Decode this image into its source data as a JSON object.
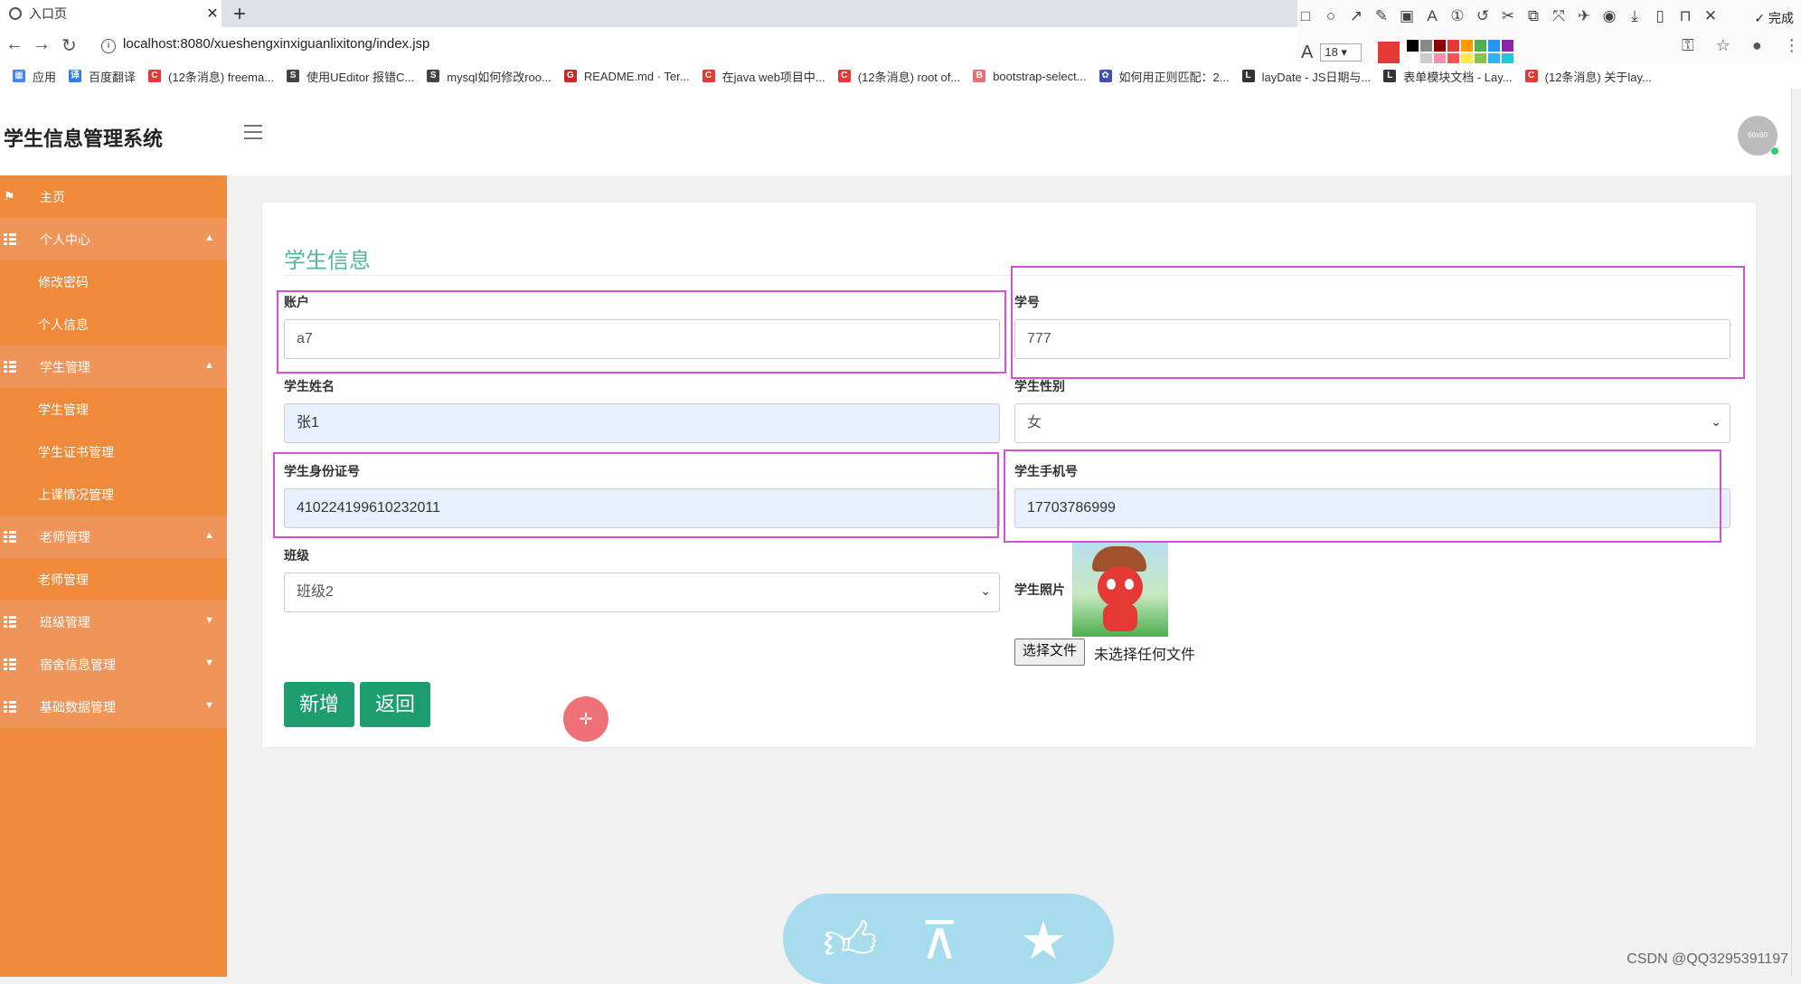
{
  "browser": {
    "tab_title": "入口页",
    "url": "localhost:8080/xueshengxinxiguanlixitong/index.jsp",
    "bookmarks": [
      {
        "label": "应用",
        "color": "#4285f4",
        "glyph": "▦"
      },
      {
        "label": "百度翻译",
        "color": "#2b7de9",
        "glyph": "译"
      },
      {
        "label": "(12条消息) freema...",
        "color": "#e53935",
        "glyph": "C"
      },
      {
        "label": "使用UEditor 报错C...",
        "color": "#444444",
        "glyph": "S"
      },
      {
        "label": "mysql如何修改roo...",
        "color": "#444444",
        "glyph": "S"
      },
      {
        "label": "README.md · Ter...",
        "color": "#c62828",
        "glyph": "G"
      },
      {
        "label": "在java web项目中...",
        "color": "#e53935",
        "glyph": "C"
      },
      {
        "label": "(12条消息) root of...",
        "color": "#e53935",
        "glyph": "C"
      },
      {
        "label": "bootstrap-select...",
        "color": "#e57373",
        "glyph": "B"
      },
      {
        "label": "如何用正则匹配：2...",
        "color": "#3f51b5",
        "glyph": "✿"
      },
      {
        "label": "layDate - JS日期与...",
        "color": "#333333",
        "glyph": "L"
      },
      {
        "label": "表单模块文档 - Lay...",
        "color": "#333333",
        "glyph": "L"
      },
      {
        "label": "(12条消息) 关于lay...",
        "color": "#e53935",
        "glyph": "C"
      }
    ],
    "annot": {
      "done_label": "完成",
      "font_size": "18",
      "current_color": "#e53935",
      "palette": [
        "#000000",
        "#888888",
        "#8b0000",
        "#e53935",
        "#ff9800",
        "#4caf50",
        "#2196f3",
        "#8e24aa",
        "#ffffff",
        "#cccccc",
        "#f48fb1",
        "#ff5252",
        "#ffeb3b",
        "#8bc34a",
        "#29b6f6",
        "#26c6da"
      ]
    }
  },
  "app": {
    "title": "学生信息管理系统",
    "avatar_text": "60x60"
  },
  "sidebar": {
    "items": [
      {
        "label": "主页",
        "type": "home"
      },
      {
        "label": "个人中心",
        "type": "section",
        "chev": "▲"
      },
      {
        "label": "修改密码",
        "type": "sub"
      },
      {
        "label": "个人信息",
        "type": "sub"
      },
      {
        "label": "学生管理",
        "type": "section",
        "chev": "▲"
      },
      {
        "label": "学生管理",
        "type": "sub"
      },
      {
        "label": "学生证书管理",
        "type": "sub"
      },
      {
        "label": "上课情况管理",
        "type": "sub"
      },
      {
        "label": "老师管理",
        "type": "section",
        "chev": "▲"
      },
      {
        "label": "老师管理",
        "type": "sub"
      },
      {
        "label": "班级管理",
        "type": "section",
        "chev": "▼"
      },
      {
        "label": "宿舍信息管理",
        "type": "section",
        "chev": "▼"
      },
      {
        "label": "基础数据管理",
        "type": "section",
        "chev": "▼"
      }
    ]
  },
  "form": {
    "title": "学生信息",
    "account": {
      "label": "账户",
      "value": "a7"
    },
    "student_no": {
      "label": "学号",
      "value": "777"
    },
    "name": {
      "label": "学生姓名",
      "value": "张1"
    },
    "gender": {
      "label": "学生性别",
      "value": "女"
    },
    "id_card": {
      "label": "学生身份证号",
      "value": "410224199610232011"
    },
    "phone": {
      "label": "学生手机号",
      "value": "17703786999"
    },
    "class": {
      "label": "班级",
      "value": "班级2"
    },
    "photo": {
      "label": "学生照片",
      "file_button": "选择文件",
      "file_status": "未选择任何文件"
    },
    "add_button": "新增",
    "back_button": "返回"
  },
  "watermark": "CSDN @QQ3295391197"
}
